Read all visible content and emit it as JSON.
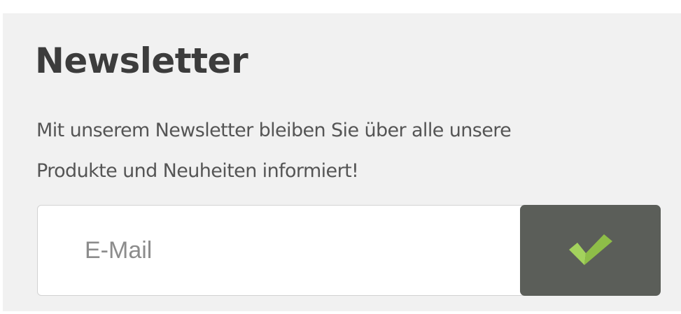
{
  "newsletter": {
    "title": "Newsletter",
    "description_lines": [
      "Mit unserem Newsletter bleiben Sie über alle unsere",
      "Produkte und Neuheiten informiert!"
    ],
    "email_placeholder": "E-Mail",
    "submit_icon": "checkmark-icon",
    "colors": {
      "panel_background": "#f1f1f1",
      "button_background": "#5b5e59",
      "checkmark_light": "#a3d25d",
      "checkmark_dark": "#8ebd48"
    }
  }
}
